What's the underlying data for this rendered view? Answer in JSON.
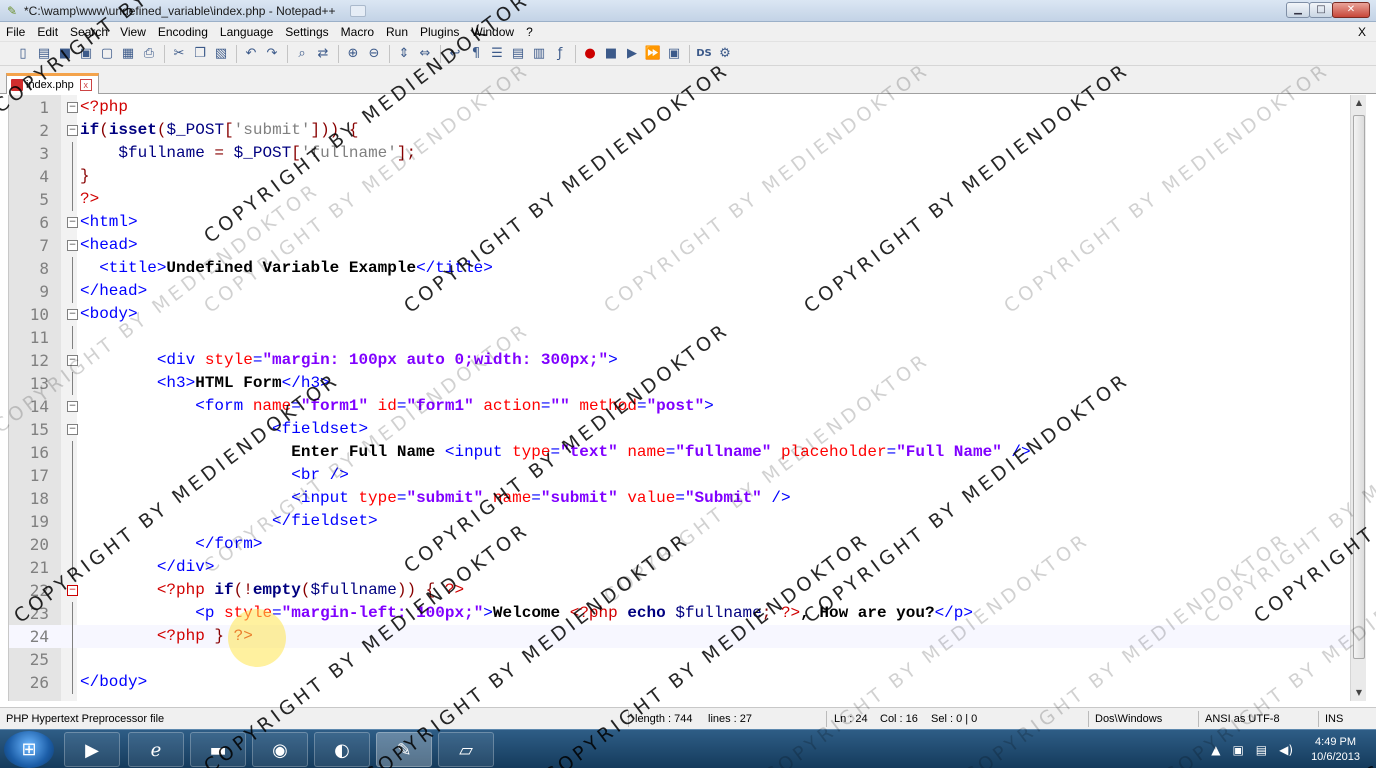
{
  "window": {
    "title": "*C:\\wamp\\www\\undefined_variable\\index.php - Notepad++",
    "controls": {
      "minimize": "▁",
      "maximize": "□",
      "close": "✕"
    }
  },
  "menu": {
    "items": [
      "File",
      "Edit",
      "Search",
      "View",
      "Encoding",
      "Language",
      "Settings",
      "Macro",
      "Run",
      "Plugins",
      "Window",
      "?"
    ],
    "close": "X"
  },
  "tab": {
    "label": "index.php",
    "close": "x"
  },
  "editor": {
    "lines": [
      {
        "n": "1",
        "fold": "minus",
        "segs": [
          [
            "c-php",
            "<?php"
          ]
        ]
      },
      {
        "n": "2",
        "fold": "minus",
        "segs": [
          [
            "c-kw",
            "if"
          ],
          [
            "c-op",
            "("
          ],
          [
            "c-kw",
            "isset"
          ],
          [
            "c-op",
            "("
          ],
          [
            "c-var",
            "$_POST"
          ],
          [
            "c-op",
            "["
          ],
          [
            "c-str",
            "'submit'"
          ],
          [
            "c-op",
            "])) {"
          ]
        ]
      },
      {
        "n": "3",
        "fold": "line",
        "segs": [
          [
            "c-plain",
            "    "
          ],
          [
            "c-var",
            "$fullname"
          ],
          [
            "c-op",
            " = "
          ],
          [
            "c-var",
            "$_POST"
          ],
          [
            "c-op",
            "["
          ],
          [
            "c-str",
            "'fullname'"
          ],
          [
            "c-op",
            "];"
          ]
        ]
      },
      {
        "n": "4",
        "fold": "line",
        "segs": [
          [
            "c-op",
            "}"
          ]
        ]
      },
      {
        "n": "5",
        "fold": "line",
        "segs": [
          [
            "c-php",
            "?>"
          ]
        ]
      },
      {
        "n": "6",
        "fold": "minus",
        "segs": [
          [
            "c-tag",
            "<html>"
          ]
        ]
      },
      {
        "n": "7",
        "fold": "minus",
        "segs": [
          [
            "c-tag",
            "<head>"
          ]
        ]
      },
      {
        "n": "8",
        "fold": "line",
        "segs": [
          [
            "c-plain",
            "  "
          ],
          [
            "c-tag",
            "<title>"
          ],
          [
            "c-txt",
            "Undefined Variable Example"
          ],
          [
            "c-tag",
            "</title>"
          ]
        ]
      },
      {
        "n": "9",
        "fold": "line",
        "segs": [
          [
            "c-tag",
            "</head>"
          ]
        ]
      },
      {
        "n": "10",
        "fold": "minus",
        "segs": [
          [
            "c-tag",
            "<body>"
          ]
        ]
      },
      {
        "n": "11",
        "fold": "line",
        "segs": []
      },
      {
        "n": "12",
        "fold": "minus",
        "segs": [
          [
            "c-plain",
            "        "
          ],
          [
            "c-tag",
            "<div "
          ],
          [
            "c-attr",
            "style"
          ],
          [
            "c-tag",
            "="
          ],
          [
            "c-val",
            "\"margin: 100px auto 0;width: 300px;\""
          ],
          [
            "c-tag",
            ">"
          ]
        ]
      },
      {
        "n": "13",
        "fold": "line",
        "segs": [
          [
            "c-plain",
            "        "
          ],
          [
            "c-tag",
            "<h3>"
          ],
          [
            "c-txt",
            "HTML Form"
          ],
          [
            "c-tag",
            "</h3>"
          ]
        ]
      },
      {
        "n": "14",
        "fold": "minus",
        "segs": [
          [
            "c-plain",
            "            "
          ],
          [
            "c-tag",
            "<form "
          ],
          [
            "c-attr",
            "name"
          ],
          [
            "c-tag",
            "="
          ],
          [
            "c-val",
            "\"form1\""
          ],
          [
            "c-tag",
            " "
          ],
          [
            "c-attr",
            "id"
          ],
          [
            "c-tag",
            "="
          ],
          [
            "c-val",
            "\"form1\""
          ],
          [
            "c-tag",
            " "
          ],
          [
            "c-attr",
            "action"
          ],
          [
            "c-tag",
            "="
          ],
          [
            "c-val",
            "\"\""
          ],
          [
            "c-tag",
            " "
          ],
          [
            "c-attr",
            "method"
          ],
          [
            "c-tag",
            "="
          ],
          [
            "c-val",
            "\"post\""
          ],
          [
            "c-tag",
            ">"
          ]
        ]
      },
      {
        "n": "15",
        "fold": "minus",
        "segs": [
          [
            "c-plain",
            "                    "
          ],
          [
            "c-tag",
            "<fieldset>"
          ]
        ]
      },
      {
        "n": "16",
        "fold": "line",
        "segs": [
          [
            "c-plain",
            "                      "
          ],
          [
            "c-txt",
            "Enter Full Name "
          ],
          [
            "c-tag",
            "<input "
          ],
          [
            "c-attr",
            "type"
          ],
          [
            "c-tag",
            "="
          ],
          [
            "c-val",
            "\"text\""
          ],
          [
            "c-tag",
            " "
          ],
          [
            "c-attr",
            "name"
          ],
          [
            "c-tag",
            "="
          ],
          [
            "c-val",
            "\"fullname\""
          ],
          [
            "c-tag",
            " "
          ],
          [
            "c-attr",
            "placeholder"
          ],
          [
            "c-tag",
            "="
          ],
          [
            "c-val",
            "\"Full Name\""
          ],
          [
            "c-tag",
            " />"
          ]
        ]
      },
      {
        "n": "17",
        "fold": "line",
        "segs": [
          [
            "c-plain",
            "                      "
          ],
          [
            "c-tag",
            "<br />"
          ]
        ]
      },
      {
        "n": "18",
        "fold": "line",
        "segs": [
          [
            "c-plain",
            "                      "
          ],
          [
            "c-tag",
            "<input "
          ],
          [
            "c-attr",
            "type"
          ],
          [
            "c-tag",
            "="
          ],
          [
            "c-val",
            "\"submit\""
          ],
          [
            "c-tag",
            " "
          ],
          [
            "c-attr",
            "name"
          ],
          [
            "c-tag",
            "="
          ],
          [
            "c-val",
            "\"submit\""
          ],
          [
            "c-tag",
            " "
          ],
          [
            "c-attr",
            "value"
          ],
          [
            "c-tag",
            "="
          ],
          [
            "c-val",
            "\"Submit\""
          ],
          [
            "c-tag",
            " />"
          ]
        ]
      },
      {
        "n": "19",
        "fold": "line",
        "segs": [
          [
            "c-plain",
            "                    "
          ],
          [
            "c-tag",
            "</fieldset>"
          ]
        ]
      },
      {
        "n": "20",
        "fold": "line",
        "segs": [
          [
            "c-plain",
            "            "
          ],
          [
            "c-tag",
            "</form>"
          ]
        ]
      },
      {
        "n": "21",
        "fold": "line",
        "segs": [
          [
            "c-plain",
            "        "
          ],
          [
            "c-tag",
            "</div>"
          ]
        ]
      },
      {
        "n": "22",
        "fold": "red",
        "segs": [
          [
            "c-plain",
            "        "
          ],
          [
            "c-php",
            "<?php "
          ],
          [
            "c-kw",
            "if"
          ],
          [
            "c-op",
            "(!"
          ],
          [
            "c-kw",
            "empty"
          ],
          [
            "c-op",
            "("
          ],
          [
            "c-var",
            "$fullname"
          ],
          [
            "c-op",
            ")) { "
          ],
          [
            "c-php",
            "?>"
          ]
        ]
      },
      {
        "n": "23",
        "fold": "line",
        "segs": [
          [
            "c-plain",
            "            "
          ],
          [
            "c-tag",
            "<p "
          ],
          [
            "c-attr",
            "style"
          ],
          [
            "c-tag",
            "="
          ],
          [
            "c-val",
            "\"margin-left: 100px;\""
          ],
          [
            "c-tag",
            ">"
          ],
          [
            "c-txt",
            "Welcome "
          ],
          [
            "c-php",
            "<?php "
          ],
          [
            "c-kw",
            "echo"
          ],
          [
            "c-var",
            " $fullname"
          ],
          [
            "c-op",
            "; "
          ],
          [
            "c-php",
            "?>"
          ],
          [
            "c-txt",
            ", How are you?"
          ],
          [
            "c-tag",
            "</p>"
          ]
        ]
      },
      {
        "n": "24",
        "fold": "line",
        "current": true,
        "segs": [
          [
            "c-plain",
            "        "
          ],
          [
            "c-php",
            "<?php "
          ],
          [
            "c-op",
            "} "
          ],
          [
            "c-php",
            "?>"
          ]
        ]
      },
      {
        "n": "25",
        "fold": "line",
        "segs": []
      },
      {
        "n": "26",
        "fold": "line",
        "segs": [
          [
            "c-tag",
            "</body>"
          ]
        ]
      }
    ]
  },
  "status": {
    "filetype": "PHP Hypertext Preprocessor file",
    "length": "length : 744",
    "lines": "lines : 27",
    "ln": "Ln : 24",
    "col": "Col : 16",
    "sel": "Sel : 0 | 0",
    "eol": "Dos\\Windows",
    "encoding": "ANSI as UTF-8",
    "mode": "INS"
  },
  "taskbar": {
    "time": "4:49 PM",
    "date": "10/6/2013"
  },
  "watermark": {
    "text": "COPYRIGHT BY MEDIENDOKTOR"
  },
  "colors": {
    "accent_tab": "#f4a34b",
    "php": "#d00000",
    "tag": "#0000ff",
    "attr": "#ff0000",
    "value": "#8000ff",
    "keyword": "#000080"
  }
}
